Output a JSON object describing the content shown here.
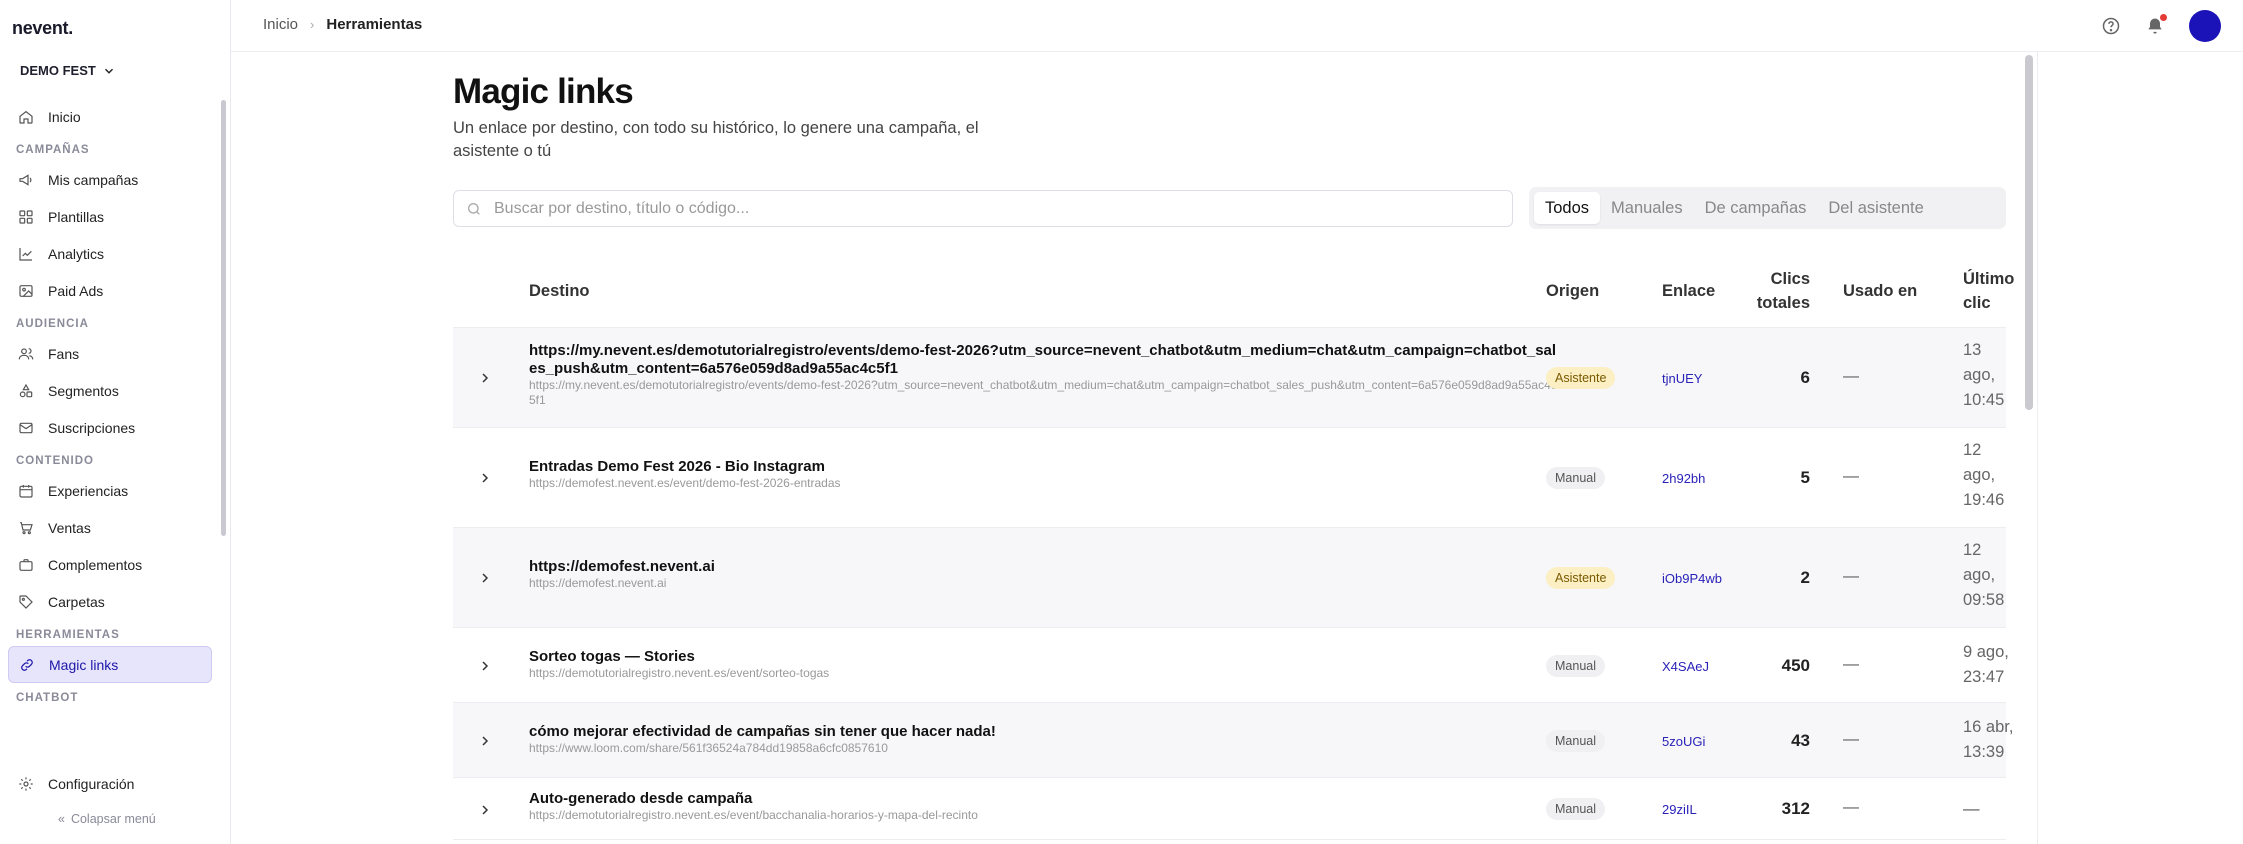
{
  "app": {
    "logo": "nevent."
  },
  "sidebar": {
    "org": "DEMO FEST",
    "home": "Inicio",
    "sections": {
      "campaigns": "CAMPAÑAS",
      "audience": "AUDIENCIA",
      "content": "CONTENIDO",
      "tools": "HERRAMIENTAS",
      "chatbot": "CHATBOT"
    },
    "items": {
      "my_campaigns": "Mis campañas",
      "templates": "Plantillas",
      "analytics": "Analytics",
      "paid_ads": "Paid Ads",
      "fans": "Fans",
      "segments": "Segmentos",
      "subscriptions": "Suscripciones",
      "experiences": "Experiencias",
      "sales": "Ventas",
      "addons": "Complementos",
      "folders": "Carpetas",
      "magic_links": "Magic links"
    },
    "config": "Configuración",
    "collapse": "Colapsar menú"
  },
  "breadcrumb": {
    "home": "Inicio",
    "current": "Herramientas"
  },
  "page": {
    "title": "Magic links",
    "subtitle": "Un enlace por destino, con todo su histórico, lo genere una campaña, el asistente o tú"
  },
  "search": {
    "placeholder": "Buscar por destino, título o código..."
  },
  "filters": [
    "Todos",
    "Manuales",
    "De campañas",
    "Del asistente"
  ],
  "table": {
    "headers": {
      "destination": "Destino",
      "origin": "Origen",
      "link": "Enlace",
      "clicks": "Clics\ntotales",
      "used_in": "Usado en",
      "last_click": "Último\nclic"
    },
    "rows": [
      {
        "title": "https://my.nevent.es/demotutorialregistro/events/demo-fest-2026?utm_source=nevent_chatbot&utm_medium=chat&utm_campaign=chatbot_sales_push&utm_content=6a576e059d8ad9a55ac4c5f1",
        "url": "https://my.nevent.es/demotutorialregistro/events/demo-fest-2026?utm_source=nevent_chatbot&utm_medium=chat&utm_campaign=chatbot_sales_push&utm_content=6a576e059d8ad9a55ac4c5f1",
        "origin": "Asistente",
        "code": "tjnUEY",
        "clicks": "6",
        "used_in": "—",
        "last_click": "13\nago,\n10:45"
      },
      {
        "title": "Entradas Demo Fest 2026 - Bio Instagram",
        "url": "https://demofest.nevent.es/event/demo-fest-2026-entradas",
        "origin": "Manual",
        "code": "2h92bh",
        "clicks": "5",
        "used_in": "—",
        "last_click": "12\nago,\n19:46"
      },
      {
        "title": "https://demofest.nevent.ai",
        "url": "https://demofest.nevent.ai",
        "origin": "Asistente",
        "code": "iOb9P4wb",
        "clicks": "2",
        "used_in": "—",
        "last_click": "12\nago,\n09:58"
      },
      {
        "title": "Sorteo togas — Stories",
        "url": "https://demotutorialregistro.nevent.es/event/sorteo-togas",
        "origin": "Manual",
        "code": "X4SAeJ",
        "clicks": "450",
        "used_in": "—",
        "last_click": "9 ago,\n23:47"
      },
      {
        "title": "cómo mejorar efectividad de campañas sin tener que hacer nada!",
        "url": "https://www.loom.com/share/561f36524a784dd19858a6cfc0857610",
        "origin": "Manual",
        "code": "5zoUGi",
        "clicks": "43",
        "used_in": "—",
        "last_click": "16 abr,\n13:39"
      },
      {
        "title": "Auto-generado desde campaña",
        "url": "https://demotutorialregistro.nevent.es/event/bacchanalia-horarios-y-mapa-del-recinto",
        "origin": "Manual",
        "code": "29ziIL",
        "clicks": "312",
        "used_in": "—",
        "last_click": "—"
      }
    ]
  },
  "colors": {
    "accent": "#1b13b7",
    "active_bg": "#e7e5fb",
    "asistente_badge": "#fcefc3"
  }
}
